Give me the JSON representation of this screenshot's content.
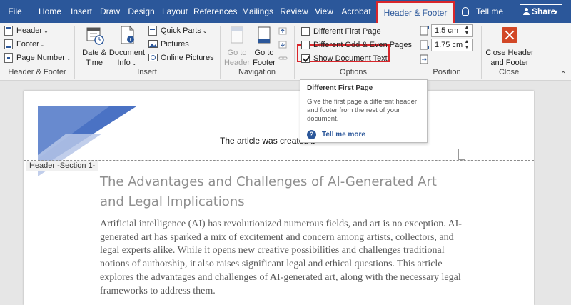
{
  "tabs": [
    {
      "label": "File"
    },
    {
      "label": "Home"
    },
    {
      "label": "Insert"
    },
    {
      "label": "Draw"
    },
    {
      "label": "Design"
    },
    {
      "label": "Layout"
    },
    {
      "label": "References"
    },
    {
      "label": "Mailings"
    },
    {
      "label": "Review"
    },
    {
      "label": "View"
    },
    {
      "label": "Acrobat"
    },
    {
      "label": "Header & Footer"
    }
  ],
  "active_tab": "Header & Footer",
  "tell_me": "Tell me",
  "share": "Share",
  "ribbon": {
    "header_footer": {
      "header": "Header",
      "footer": "Footer",
      "page_number": "Page Number",
      "label": "Header & Footer"
    },
    "insert": {
      "date_time": [
        "Date &",
        "Time"
      ],
      "document_info": [
        "Document",
        "Info"
      ],
      "quick_parts": "Quick Parts",
      "pictures": "Pictures",
      "online_pictures": "Online Pictures",
      "label": "Insert"
    },
    "navigation": {
      "goto_header": [
        "Go to",
        "Header"
      ],
      "goto_footer": [
        "Go to",
        "Footer"
      ],
      "label": "Navigation"
    },
    "options": {
      "different_first_page": {
        "label": "Different First Page",
        "checked": false
      },
      "different_odd_even": {
        "label": "Different Odd & Even Pages",
        "checked": false
      },
      "show_document_text": {
        "label": "Show Document Text",
        "checked": true
      },
      "label": "Options"
    },
    "position": {
      "header_from_top": "1.5 cm",
      "footer_from_bottom": "1.75 cm",
      "label": "Position"
    },
    "close": {
      "button": [
        "Close Header",
        "and Footer"
      ],
      "label": "Close"
    }
  },
  "tooltip": {
    "title": "Different First Page",
    "description": "Give the first page a different header and footer from the rest of your document.",
    "help_link": "Tell me more"
  },
  "document": {
    "header_tag": "Header -Section 1-",
    "header_text": "The article was created b",
    "title": "The Advantages and Challenges of AI-Generated Art and Legal Implications",
    "body": "Artificial intelligence (AI) has revolutionized numerous fields, and art is no exception. AI-generated art has sparked a mix of excitement and concern among artists, collectors, and legal experts alike. While it opens new creative possibilities and challenges traditional notions of authorship, it also raises significant legal and ethical questions. This article explores the advantages and challenges of AI-generated art, along with the necessary legal frameworks to address them."
  },
  "colors": {
    "accent": "#2b579a",
    "highlight": "#d9262b",
    "close_button": "#d24726"
  }
}
